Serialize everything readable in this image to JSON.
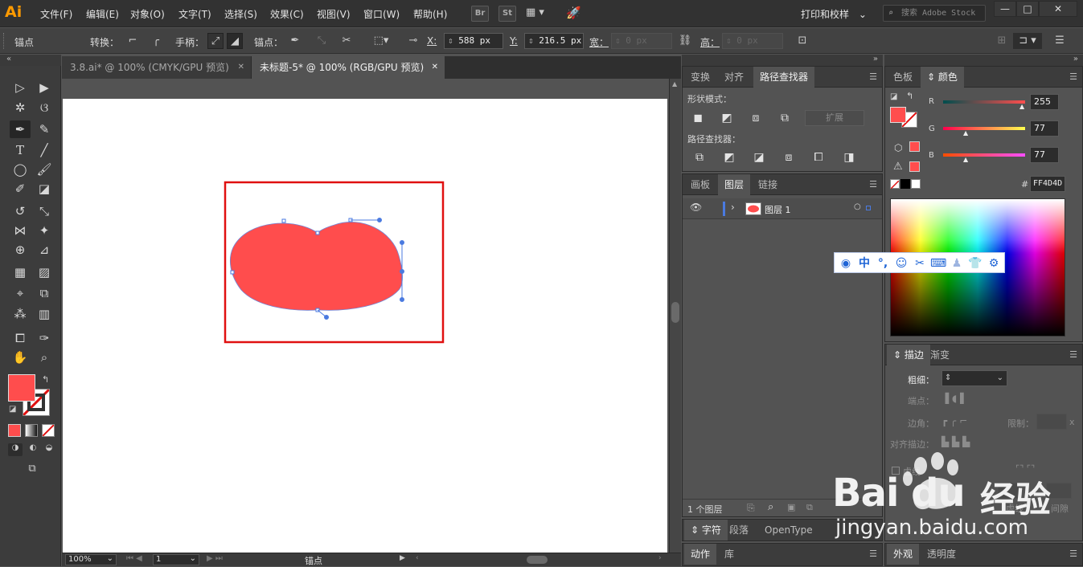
{
  "app": {
    "logo": "Ai"
  },
  "menu": [
    "文件(F)",
    "编辑(E)",
    "对象(O)",
    "文字(T)",
    "选择(S)",
    "效果(C)",
    "视图(V)",
    "窗口(W)",
    "帮助(H)"
  ],
  "bridge_labels": {
    "br": "Br",
    "st": "St"
  },
  "workspace": "打印和校样",
  "stock_search_placeholder": "搜索 Adobe Stock",
  "window_controls": [
    "—",
    "□",
    "✕"
  ],
  "control_bar": {
    "anchor_label": "锚点",
    "convert_label": "转换：",
    "handle_label": "手柄：",
    "anchor_point_label": "锚点：",
    "x_label": "X:",
    "x_value": "588 px",
    "y_label": "Y:",
    "y_value": "216.5 px",
    "width_label": "宽：",
    "width_value": "0 px",
    "height_label": "高：",
    "height_value": "0 px"
  },
  "tabs": [
    {
      "label": "3.8.ai* @ 100% (CMYK/GPU 预览)",
      "close": "✕"
    },
    {
      "label": "未标题-5* @ 100% (RGB/GPU 预览)",
      "close": "✕"
    }
  ],
  "shape": {
    "fill": "#FF4D4D",
    "selection_stroke": "#e01010"
  },
  "status": {
    "zoom": "100%",
    "artboard": "1",
    "tool_name": "锚点"
  },
  "pathfinder_panel": {
    "tabs": [
      "变换",
      "对齐",
      "路径查找器"
    ],
    "shape_modes_label": "形状模式：",
    "expand_button": "扩展",
    "pathfinders_label": "路径查找器："
  },
  "layers_panel": {
    "tabs": [
      "画板",
      "图层",
      "链接"
    ],
    "layer_name": "图层 1",
    "footer": "1 个图层"
  },
  "char_panel": {
    "tabs": [
      "字符",
      "段落",
      "OpenType"
    ]
  },
  "actions_panel": {
    "tabs": [
      "动作",
      "库"
    ]
  },
  "color_panel": {
    "tabs": [
      "色板",
      "颜色"
    ],
    "r_label": "R",
    "r_value": "255",
    "g_label": "G",
    "g_value": "77",
    "b_label": "B",
    "b_value": "77",
    "hash": "#",
    "hex_value": "FF4D4D",
    "current_color": "#FF4D4D"
  },
  "stroke_panel": {
    "tabs": [
      "描边",
      "渐变"
    ],
    "weight_label": "粗细：",
    "cap_label": "端点：",
    "corner_label": "边角：",
    "limit_label": "限制：",
    "limit_unit": "x",
    "align_label": "对齐描边：",
    "dashed_label": "虚线",
    "dash_label": "虚线",
    "gap_label": "间隙"
  },
  "appearance_panel": {
    "tabs": [
      "外观",
      "透明度"
    ]
  },
  "baidu_toolbar": {
    "zh_label": "中"
  },
  "watermark": {
    "logo_text": "Bai du",
    "brand": "经验",
    "url": "jingyan.baidu.com"
  }
}
